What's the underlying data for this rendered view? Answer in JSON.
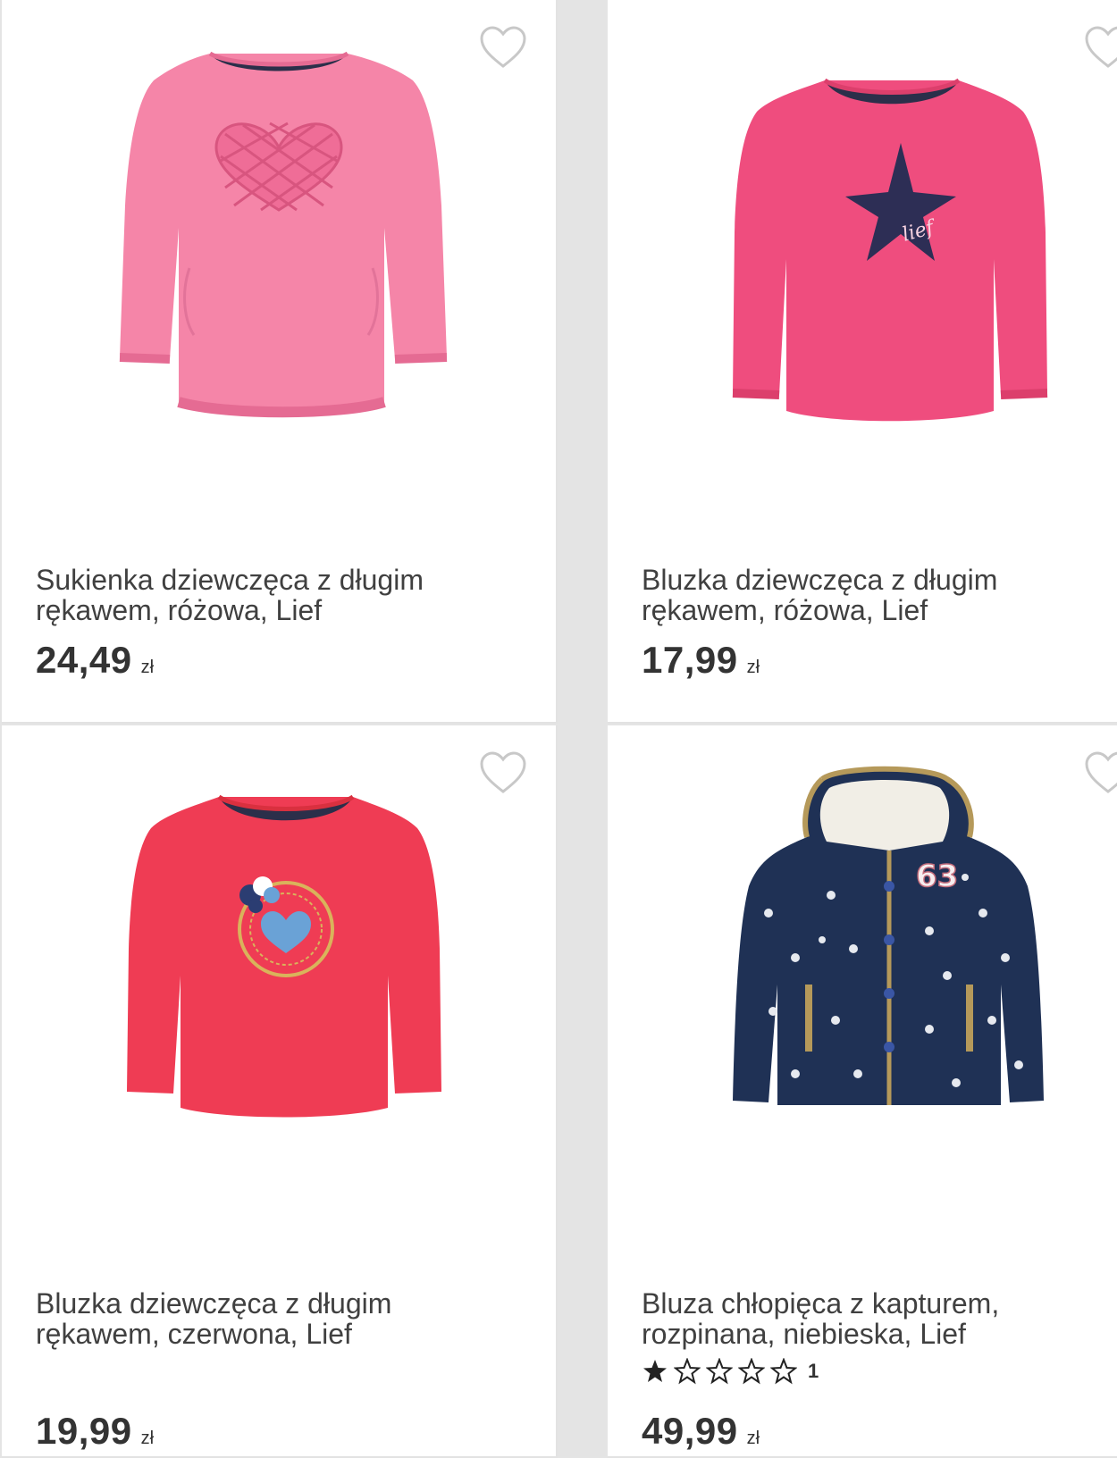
{
  "products": [
    {
      "title": "Sukienka dziewczęca z długim rękawem, różowa, Lief",
      "price": "24,49",
      "currency": "zł",
      "image_icon": "pink-dress-heart-icon",
      "color": "#f27fa5"
    },
    {
      "title": "Bluzka dziewczęca z długim rękawem, różowa, Lief",
      "price": "17,99",
      "currency": "zł",
      "image_icon": "pink-blouse-star-icon",
      "color": "#ef4d7e"
    },
    {
      "title": "Bluzka dziewczęca z długim rękawem, czerwona, Lief",
      "price": "19,99",
      "currency": "zł",
      "image_icon": "red-blouse-heart-badge-icon",
      "color": "#ef3c54"
    },
    {
      "title": "Bluza chłopięca z kapturem, rozpinana, niebieska, Lief",
      "price": "49,99",
      "currency": "zł",
      "image_icon": "navy-star-hoodie-icon",
      "color": "#1f3155",
      "rating": {
        "value": 1,
        "max": 5,
        "count": "1"
      }
    }
  ],
  "wishlist_icon": "heart-outline-icon"
}
